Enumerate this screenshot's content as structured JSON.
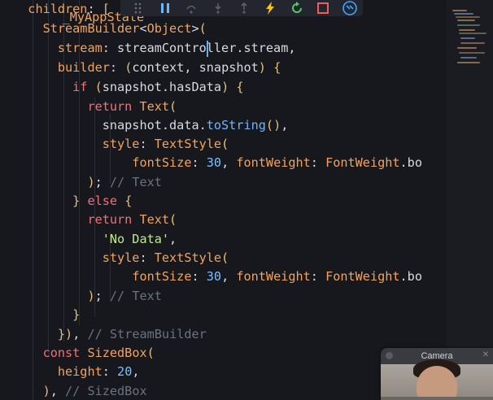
{
  "debug_toolbar": {
    "buttons": [
      {
        "name": "drag-handle",
        "icon": "grip-icon"
      },
      {
        "name": "pause",
        "icon": "pause-icon"
      },
      {
        "name": "step-over",
        "icon": "step-over-icon"
      },
      {
        "name": "step-into",
        "icon": "step-into-icon"
      },
      {
        "name": "step-out",
        "icon": "step-out-icon"
      },
      {
        "name": "hot-reload",
        "icon": "lightning-icon"
      },
      {
        "name": "restart",
        "icon": "restart-icon"
      },
      {
        "name": "stop",
        "icon": "stop-icon"
      },
      {
        "name": "devtools",
        "icon": "devtools-icon"
      }
    ],
    "colors": {
      "pause": "#6cb6ff",
      "reload": "#f5c518",
      "restart": "#5ac864",
      "stop": "#f25c5c",
      "devtools": "#3ea6ff"
    }
  },
  "code": {
    "header_fragment": "_MyAppState",
    "lines": [
      {
        "indent": "  ",
        "text": "children: ["
      },
      {
        "indent": "    ",
        "text": "StreamBuilder<Object>("
      },
      {
        "indent": "      ",
        "text": "stream: streamController.stream,"
      },
      {
        "indent": "      ",
        "text": "builder: (context, snapshot) {"
      },
      {
        "indent": "        ",
        "text": "if (snapshot.hasData) {"
      },
      {
        "indent": "          ",
        "text": "return Text("
      },
      {
        "indent": "            ",
        "text": "snapshot.data.toString(),"
      },
      {
        "indent": "            ",
        "text": "style: TextStyle("
      },
      {
        "indent": "                ",
        "text": "fontSize: 30, fontWeight: FontWeight.bo"
      },
      {
        "indent": "          ",
        "text": "); // Text"
      },
      {
        "indent": "        ",
        "text": "} else {"
      },
      {
        "indent": "          ",
        "text": "return Text("
      },
      {
        "indent": "            ",
        "text": "'No Data',"
      },
      {
        "indent": "            ",
        "text": "style: TextStyle("
      },
      {
        "indent": "                ",
        "text": "fontSize: 30, fontWeight: FontWeight.bo"
      },
      {
        "indent": "          ",
        "text": "); // Text"
      },
      {
        "indent": "        ",
        "text": "}"
      },
      {
        "indent": "      ",
        "text": "}), // StreamBuilder"
      },
      {
        "indent": "    ",
        "text": "const SizedBox("
      },
      {
        "indent": "      ",
        "text": "height: 20,"
      },
      {
        "indent": "    ",
        "text": "), // SizedBox"
      }
    ]
  },
  "camera_window": {
    "title": "Camera"
  }
}
